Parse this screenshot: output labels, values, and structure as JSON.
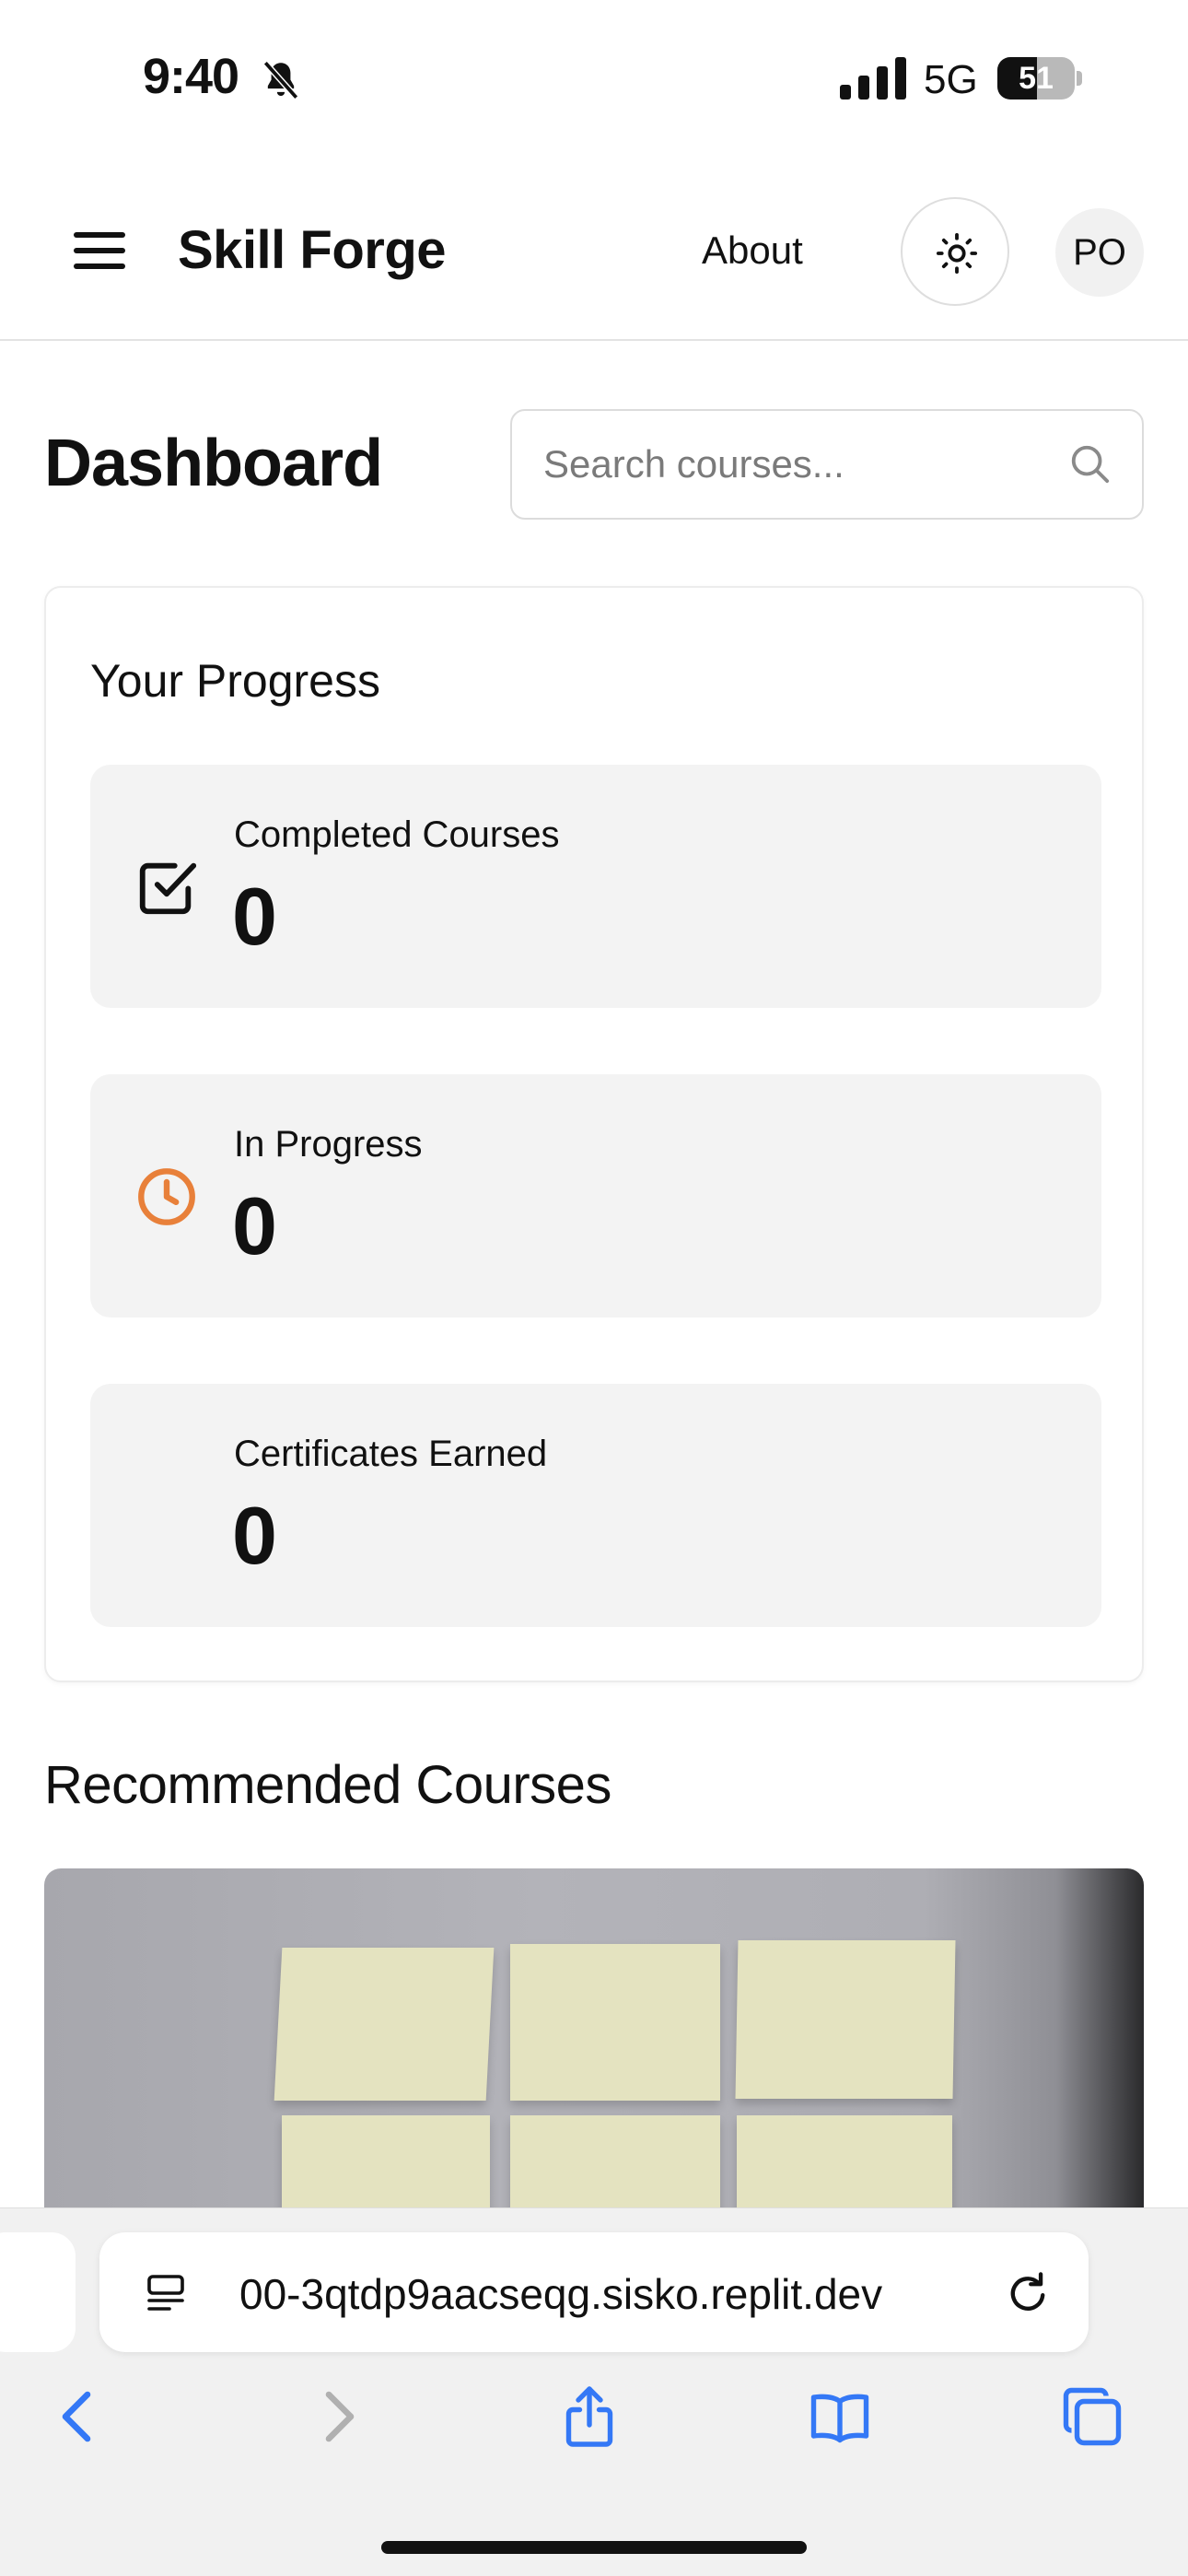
{
  "status_bar": {
    "time": "9:40",
    "network": "5G",
    "battery_percent": 51,
    "battery_label": "51"
  },
  "header": {
    "brand": "Skill Forge",
    "about_label": "About",
    "avatar_initials": "PO"
  },
  "dashboard": {
    "title": "Dashboard",
    "search_placeholder": "Search courses..."
  },
  "progress": {
    "title": "Your Progress",
    "stats": [
      {
        "label": "Completed Courses",
        "value": "0",
        "icon": "check-square-icon"
      },
      {
        "label": "In Progress",
        "value": "0",
        "icon": "clock-icon"
      },
      {
        "label": "Certificates Earned",
        "value": "0",
        "icon": ""
      }
    ]
  },
  "recommended": {
    "title": "Recommended Courses"
  },
  "browser": {
    "url": "00-3qtdp9aacseqg.sisko.replit.dev"
  },
  "colors": {
    "accent_orange": "#e8803a",
    "card_bg": "#f3f3f3",
    "safari_blue": "#3478f6"
  }
}
